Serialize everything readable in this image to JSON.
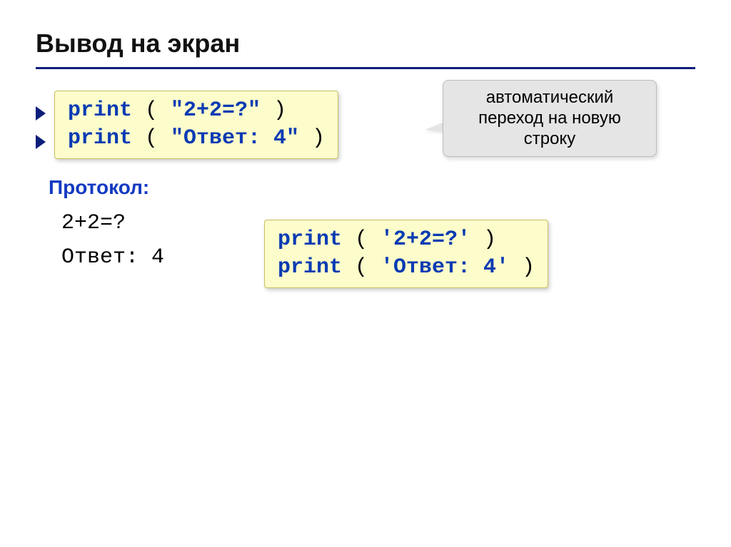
{
  "title": "Вывод на экран",
  "callout": "автоматический переход на новую строку",
  "code1": {
    "line1": {
      "kw": "print",
      "open": " ( ",
      "arg": "\"2+2=?\"",
      "close": " )"
    },
    "line2": {
      "kw": "print",
      "open": " ( ",
      "arg": "\"Ответ: 4\"",
      "close": " )"
    }
  },
  "protocol_label": "Протокол:",
  "output": {
    "line1": "2+2=?",
    "line2": "Ответ: 4"
  },
  "code2": {
    "line1": {
      "kw": "print",
      "open": " ( ",
      "arg": "'2+2=?'",
      "close": " )"
    },
    "line2": {
      "kw": "print",
      "open": " ( ",
      "arg": "'Ответ: 4'",
      "close": " )"
    }
  }
}
